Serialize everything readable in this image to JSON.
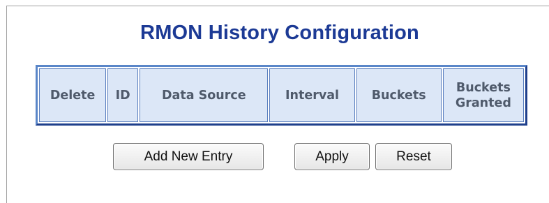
{
  "page": {
    "title": "RMON History Configuration"
  },
  "table": {
    "headers": {
      "delete": "Delete",
      "id": "ID",
      "data_source": "Data Source",
      "interval": "Interval",
      "buckets": "Buckets",
      "buckets_granted_line1": "Buckets",
      "buckets_granted_line2": "Granted"
    }
  },
  "buttons": {
    "add_new_entry": "Add New Entry",
    "apply": "Apply",
    "reset": "Reset"
  },
  "colors": {
    "title": "#1c3a95",
    "header_bg": "#dce7f7",
    "header_text": "#4f5a6b",
    "table_border": "#5a86c8"
  }
}
